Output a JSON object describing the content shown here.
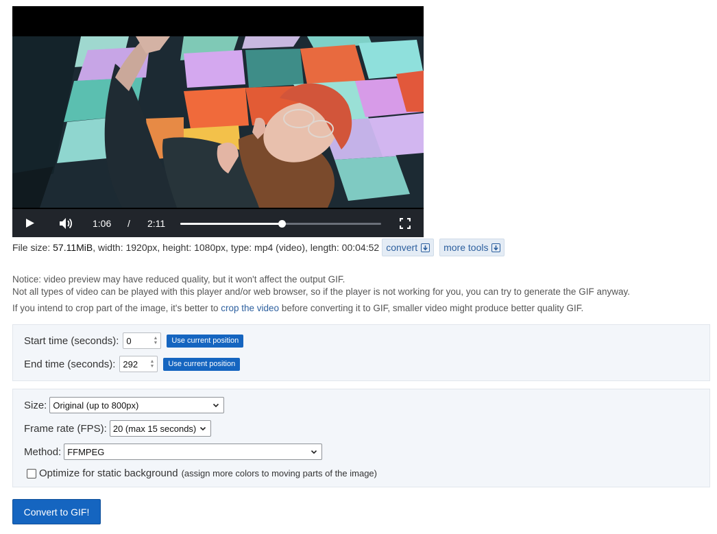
{
  "player": {
    "current_time": "1:06",
    "separator": "/",
    "duration": "2:11",
    "progress": 0.504
  },
  "file_info": {
    "prefix": "File size: ",
    "size": "57.11MiB",
    "details": ", width: 1920px, height: 1080px, type: mp4 (video), length: 00:04:52",
    "convert_label": "convert",
    "more_tools_label": "more tools"
  },
  "notices": {
    "line1": "Notice: video preview may have reduced quality, but it won't affect the output GIF.",
    "line2": "Not all types of video can be played with this player and/or web browser, so if the player is not working for you, you can try to generate the GIF anyway.",
    "line3_before": "If you intend to crop part of the image, it's better to ",
    "line3_link": "crop the video",
    "line3_after": " before converting it to GIF, smaller video might produce better quality GIF."
  },
  "trim": {
    "start_label": "Start time (seconds):",
    "start_value": "0",
    "end_label": "End time (seconds):",
    "end_value": "292",
    "use_current_label": "Use current position"
  },
  "options": {
    "size_label": "Size:",
    "size_value": "Original (up to 800px)",
    "fps_label": "Frame rate (FPS):",
    "fps_value": "20 (max 15 seconds)",
    "method_label": "Method:",
    "method_value": "FFMPEG",
    "optimize_label": "Optimize for static background",
    "optimize_note": "(assign more colors to moving parts of the image)",
    "optimize_checked": false
  },
  "submit_label": "Convert to GIF!",
  "colors": {
    "accent": "#1565c0",
    "link": "#2c5f9e",
    "panel_bg": "#f3f6fa",
    "player_bar": "#21252b"
  }
}
